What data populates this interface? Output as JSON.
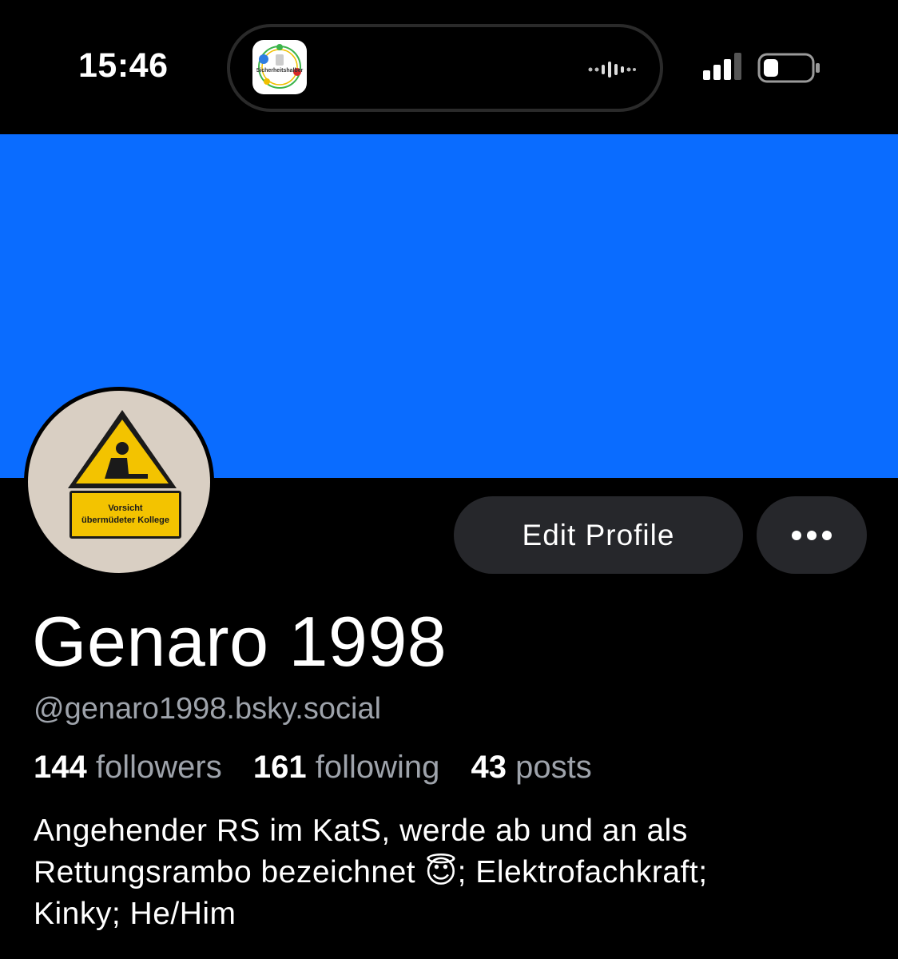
{
  "status_bar": {
    "time": "15:46",
    "live_activity_app_label": "Sicherheitshalber",
    "icons": [
      "app-icon",
      "waveform-icon",
      "signal-icon",
      "battery-icon"
    ]
  },
  "profile": {
    "banner_color": "#0a6cff",
    "avatar_sign_line1": "Vorsicht",
    "avatar_sign_line2": "übermüdeter Kollege",
    "display_name": "Genaro 1998",
    "handle": "@genaro1998.bsky.social",
    "stats": {
      "followers_count": "144",
      "followers_label": "followers",
      "following_count": "161",
      "following_label": "following",
      "posts_count": "43",
      "posts_label": "posts"
    },
    "bio_line1": "Angehender RS im KatS, werde ab und an als",
    "bio_line2_a": "Rettungsrambo bezeichnet",
    "bio_emoji": "😇",
    "bio_line2_b": "; Elektrofachkraft;",
    "bio_line3": "Kinky; He/Him"
  },
  "actions": {
    "edit_profile_label": "Edit Profile",
    "more_icon": "ellipsis-icon"
  },
  "colors": {
    "background": "#000000",
    "button_bg": "#26272b",
    "muted_text": "#9ea3ab",
    "accent_blue": "#0a6cff",
    "sign_yellow": "#f3c300"
  }
}
